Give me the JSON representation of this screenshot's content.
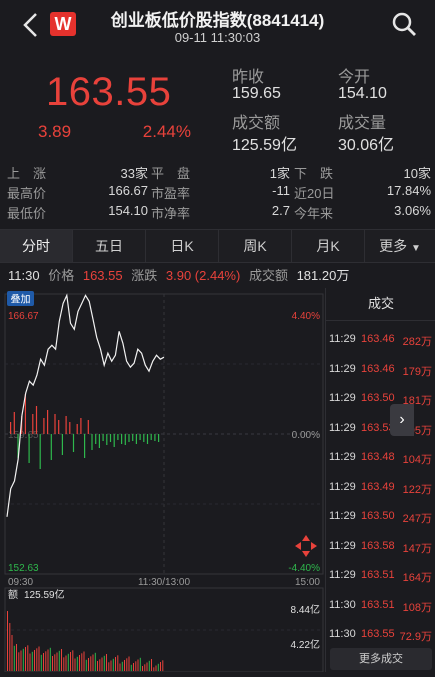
{
  "header": {
    "logo_letter": "W",
    "title": "创业板低价股指数(8841414)",
    "datetime": "09-11 11:30:03"
  },
  "quote": {
    "price": "163.55",
    "change": "3.89",
    "change_pct": "2.44%",
    "fields": [
      {
        "label": "昨收",
        "value": "159.65"
      },
      {
        "label": "今开",
        "value": "154.10"
      },
      {
        "label": "成交额",
        "value": "125.59亿"
      },
      {
        "label": "成交量",
        "value": "30.06亿"
      }
    ]
  },
  "stats": [
    [
      {
        "label": "上　涨",
        "value": "33家"
      },
      {
        "label": "平　盘",
        "value": "1家"
      },
      {
        "label": "下　跌",
        "value": "10家"
      }
    ],
    [
      {
        "label": "最高价",
        "value": "166.67"
      },
      {
        "label": "市盈率",
        "value": "-11"
      },
      {
        "label": "近20日",
        "value": "17.84%"
      }
    ],
    [
      {
        "label": "最低价",
        "value": "154.10"
      },
      {
        "label": "市净率",
        "value": "2.7"
      },
      {
        "label": "今年来",
        "value": "3.06%"
      }
    ]
  ],
  "tabs": [
    "分时",
    "五日",
    "日K",
    "周K",
    "月K",
    "更多"
  ],
  "info": {
    "time": "11:30",
    "price_label": "价格",
    "price": "163.55",
    "change_label": "涨跌",
    "change": "3.90 (2.44%)",
    "amount_label": "成交额",
    "amount": "181.20万"
  },
  "chart": {
    "badge": "叠加",
    "y_top": "166.67",
    "y_bottom": "152.63",
    "pct_top": "4.40%",
    "pct_mid": "0.00%",
    "pct_bottom": "-4.40%",
    "mid_label": "159.65",
    "time_start": "09:30",
    "time_mid": "11:30/13:00",
    "time_end": "15:00",
    "vol_label": "额",
    "vol_value": "125.59亿",
    "vol_tick_1": "8.44亿",
    "vol_tick_2": "4.22亿",
    "colors": {
      "up": "#e8423b",
      "down": "#2fb84d",
      "line": "#f2f2f2"
    }
  },
  "trades": {
    "title": "成交",
    "rows": [
      {
        "time": "11:29",
        "price": "163.46",
        "vol": "282万"
      },
      {
        "time": "11:29",
        "price": "163.46",
        "vol": "179万"
      },
      {
        "time": "11:29",
        "price": "163.50",
        "vol": "181万"
      },
      {
        "time": "11:29",
        "price": "163.53",
        "vol": "295万"
      },
      {
        "time": "11:29",
        "price": "163.48",
        "vol": "104万"
      },
      {
        "time": "11:29",
        "price": "163.49",
        "vol": "122万"
      },
      {
        "time": "11:29",
        "price": "163.50",
        "vol": "247万"
      },
      {
        "time": "11:29",
        "price": "163.58",
        "vol": "147万"
      },
      {
        "time": "11:29",
        "price": "163.51",
        "vol": "164万"
      },
      {
        "time": "11:30",
        "price": "163.51",
        "vol": "108万"
      },
      {
        "time": "11:30",
        "price": "163.55",
        "vol": "72.9万"
      }
    ],
    "more_label": "更多成交"
  }
}
